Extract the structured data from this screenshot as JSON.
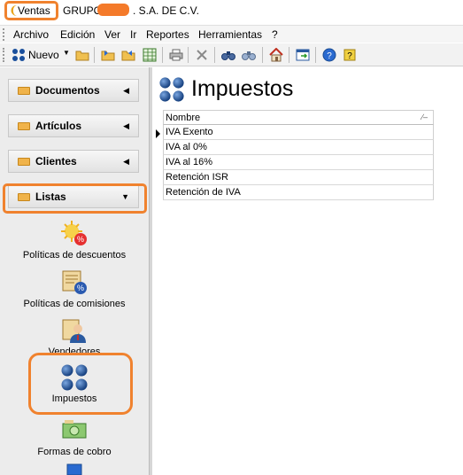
{
  "titlebar": {
    "app_name": "Ventas",
    "company_prefix": "GRUPO",
    "company_suffix": ". S.A. DE C.V."
  },
  "menu": [
    "Archivo",
    "Edición",
    "Ver",
    "Ir",
    "Reportes",
    "Herramientas",
    "?"
  ],
  "toolbar": {
    "new_label": "Nuevo",
    "icons": [
      "new-icon",
      "open-folder-icon",
      "import-icon",
      "export-icon",
      "spreadsheet-icon",
      "print-icon",
      "delete-icon",
      "find-icon",
      "find-next-icon",
      "home-icon",
      "window-icon",
      "help-icon",
      "whats-this-icon"
    ]
  },
  "sidebar": {
    "sections": [
      {
        "label": "Documentos",
        "expanded": false
      },
      {
        "label": "Artículos",
        "expanded": false
      },
      {
        "label": "Clientes",
        "expanded": false
      },
      {
        "label": "Listas",
        "expanded": true
      }
    ],
    "list_items": [
      {
        "label": "Políticas de descuentos",
        "icon": "discount-policy-icon"
      },
      {
        "label": "Políticas de comisiones",
        "icon": "commission-policy-icon"
      },
      {
        "label": "Vendedores",
        "icon": "salesperson-icon"
      },
      {
        "label": "Impuestos",
        "icon": "taxes-icon"
      },
      {
        "label": "Formas de cobro",
        "icon": "payment-methods-icon"
      }
    ]
  },
  "main": {
    "title": "Impuestos",
    "grid": {
      "column": "Nombre",
      "rows": [
        "IVA Exento",
        "IVA al 0%",
        "IVA al 16%",
        "Retención ISR",
        "Retención de IVA"
      ],
      "selected_row": 0
    }
  },
  "colors": {
    "highlight": "#f0822e",
    "tax_icon": "#1a4f9c"
  }
}
